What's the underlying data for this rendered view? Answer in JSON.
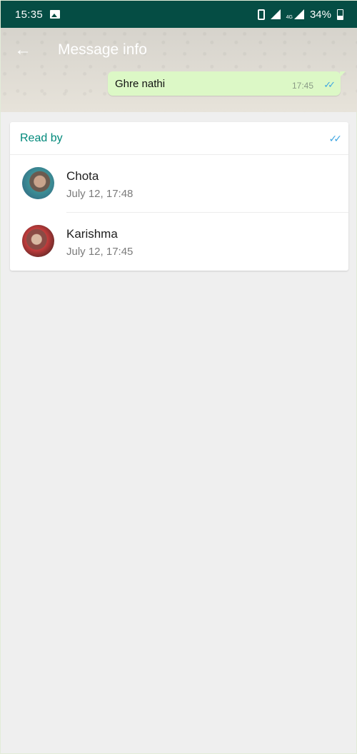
{
  "status_bar": {
    "time": "15:35",
    "network": "4G",
    "battery": "34%"
  },
  "header": {
    "title": "Message info"
  },
  "message": {
    "text": "Ghre nathi",
    "time": "17:45",
    "status_icon": "double-check-icon"
  },
  "read_by": {
    "heading": "Read by",
    "entries": [
      {
        "name": "Chota",
        "time": "July 12, 17:48"
      },
      {
        "name": "Karishma",
        "time": "July 12, 17:45"
      }
    ]
  },
  "colors": {
    "status_bar": "#054d44",
    "accent": "#00897b",
    "read_ticks": "#3ea6e2",
    "bubble": "#dcf8c6",
    "background": "#efefef"
  }
}
